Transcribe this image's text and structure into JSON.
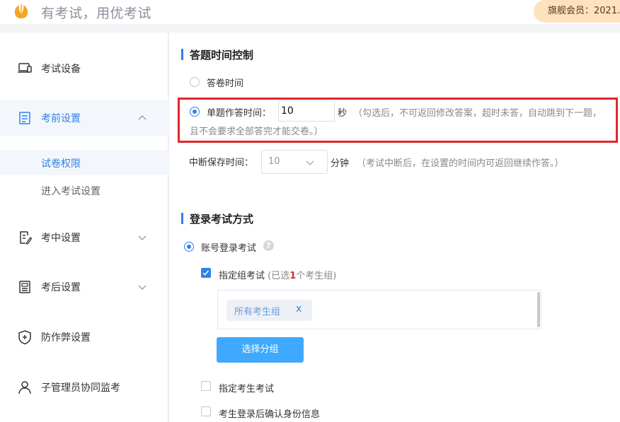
{
  "header": {
    "slogan": "有考试，用优考试",
    "member_badge": "旗舰会员：2021."
  },
  "sidebar": {
    "items": [
      {
        "label": "考试设备",
        "icon": "laptop-icon"
      },
      {
        "label": "考前设置",
        "icon": "document-icon",
        "expanded": true
      },
      {
        "label": "考中设置",
        "icon": "edit-document-icon"
      },
      {
        "label": "考后设置",
        "icon": "score-sheet-icon"
      },
      {
        "label": "防作弊设置",
        "icon": "shield-icon"
      },
      {
        "label": "子管理员协同监考",
        "icon": "user-icon"
      }
    ],
    "sub_items": [
      {
        "label": "试卷权限",
        "active": true
      },
      {
        "label": "进入考试设置"
      }
    ]
  },
  "time_control": {
    "title": "答题时间控制",
    "option_paper": "答卷时间",
    "option_single": "单题作答时间：",
    "single_value": "10",
    "single_unit": "秒",
    "single_hint_1": "（勾选后，不可返回修改答案，超时未答，自动跳到下一题，",
    "single_hint_2": "且不会要求全部答完才能交卷。）",
    "break_label": "中断保存时间：",
    "break_value": "10",
    "break_unit": "分钟",
    "break_hint": "（考试中断后，在设置的时间内可返回继续作答。）"
  },
  "login": {
    "title": "登录考试方式",
    "option_account": "账号登录考试",
    "help": "?",
    "group_label": "指定组考试",
    "group_selected_prefix": "(已选",
    "group_selected_count": "1",
    "group_selected_suffix": "个考生组)",
    "tag": "所有考生组",
    "tag_remove": "x",
    "select_group_button": "选择分组",
    "assign_examinee": "指定考生考试",
    "confirm_identity": "考生登录后确认身份信息"
  },
  "colors": {
    "accent": "#2f80ed",
    "highlight_box": "#e0262b",
    "button": "#3fa9ff",
    "count": "#e0262b",
    "member_badge_bg": "#fde2bd"
  }
}
